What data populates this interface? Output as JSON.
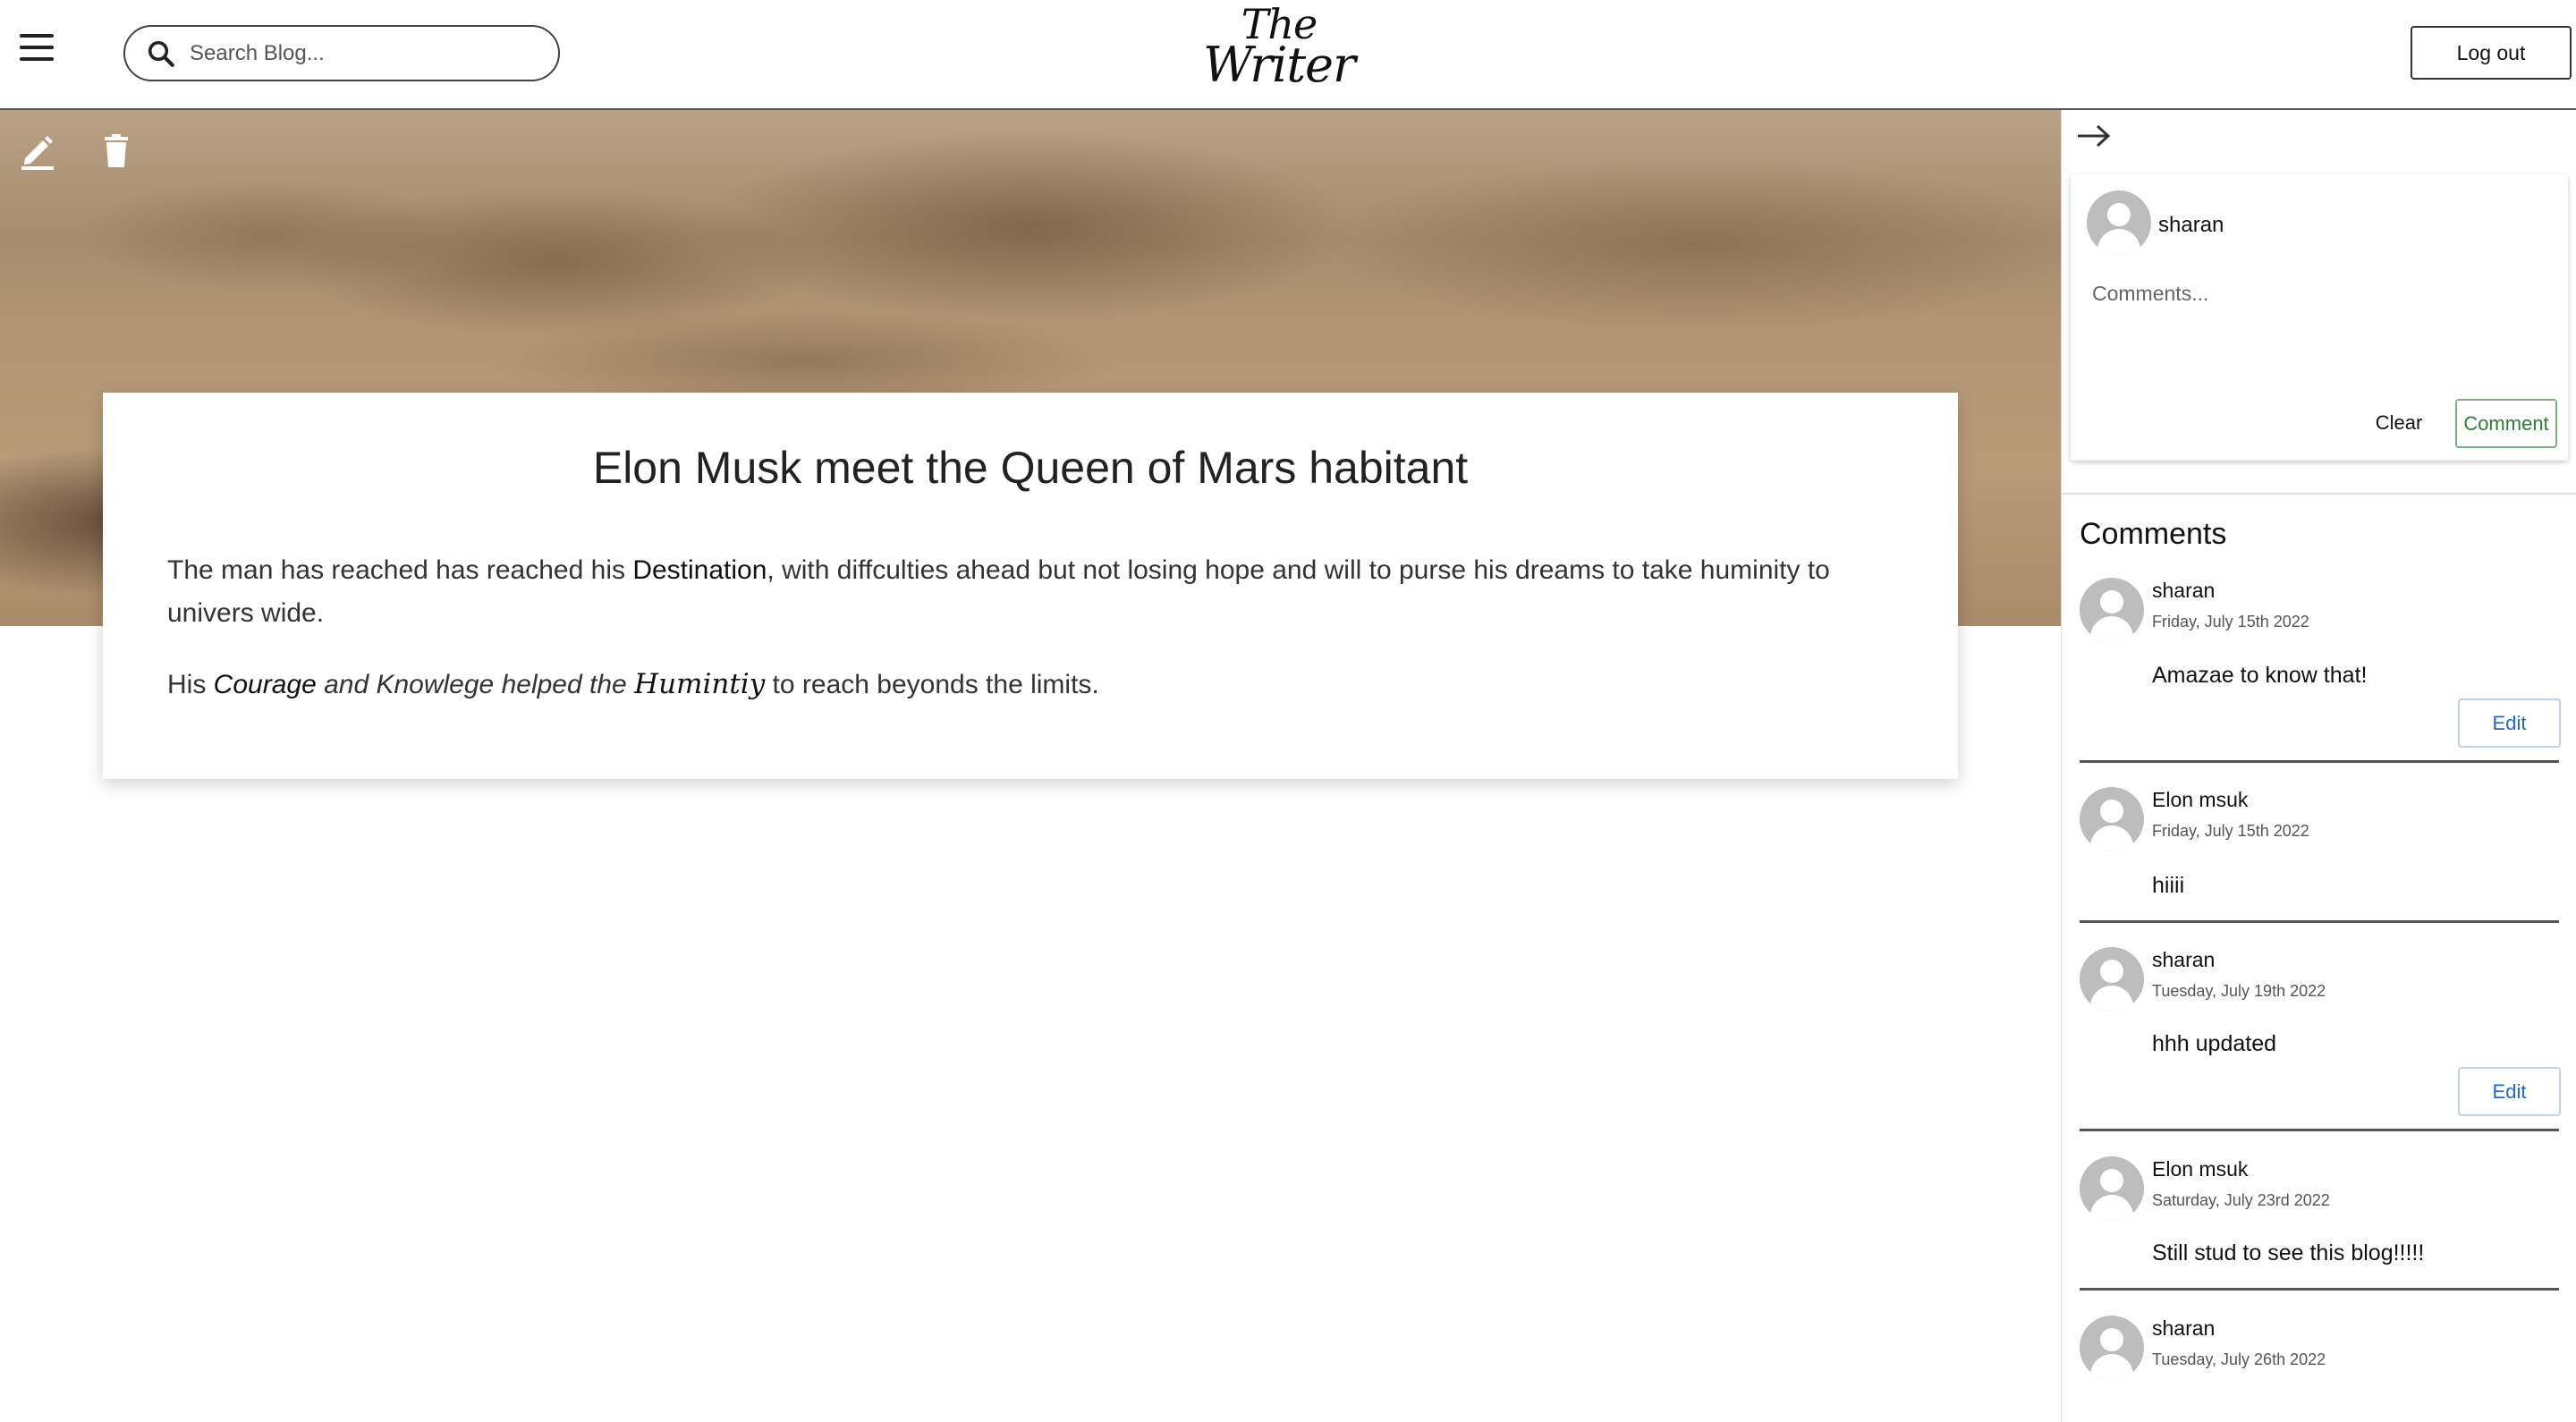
{
  "header": {
    "search_placeholder": "Search Blog...",
    "logo_line1": "The",
    "logo_line2": "Writer",
    "logout_label": "Log out"
  },
  "post": {
    "title": "Elon Musk meet the Queen of Mars habitant",
    "p1_before": "The man has reached has reached his ",
    "p1_bold": "Destination",
    "p1_after": ", with diffculties ahead but not losing hope and will to purse his dreams to take huminity to univers wide.",
    "p2_start": "His ",
    "p2_courage": "Courage",
    "p2_italic": " and Knowlege helped the ",
    "p2_humintiy": "Humintiy",
    "p2_end": " to reach beyonds the limits."
  },
  "composer": {
    "user": "sharan",
    "placeholder": "Comments...",
    "clear_label": "Clear",
    "comment_label": "Comment"
  },
  "comments": {
    "heading": "Comments",
    "items": [
      {
        "name": "sharan",
        "date": "Friday, July 15th 2022",
        "text": "Amazae to know that!",
        "edit_label": "Edit"
      },
      {
        "name": "Elon msuk",
        "date": "Friday, July 15th 2022",
        "text": "hiiii"
      },
      {
        "name": "sharan",
        "date": "Tuesday, July 19th 2022",
        "text": "hhh updated",
        "edit_label": "Edit"
      },
      {
        "name": "Elon msuk",
        "date": "Saturday, July 23rd 2022",
        "text": "Still stud to see this blog!!!!!"
      },
      {
        "name": "sharan",
        "date": "Tuesday, July 26th 2022"
      }
    ]
  },
  "icons": {
    "menu": "hamburger-menu-icon",
    "search": "search-icon",
    "edit": "pencil-icon",
    "delete": "trash-icon",
    "collapse": "arrow-right-icon",
    "avatar": "person-icon"
  },
  "colors": {
    "comment_button": "#2e7d32",
    "edit_button": "#1e6cc0"
  }
}
